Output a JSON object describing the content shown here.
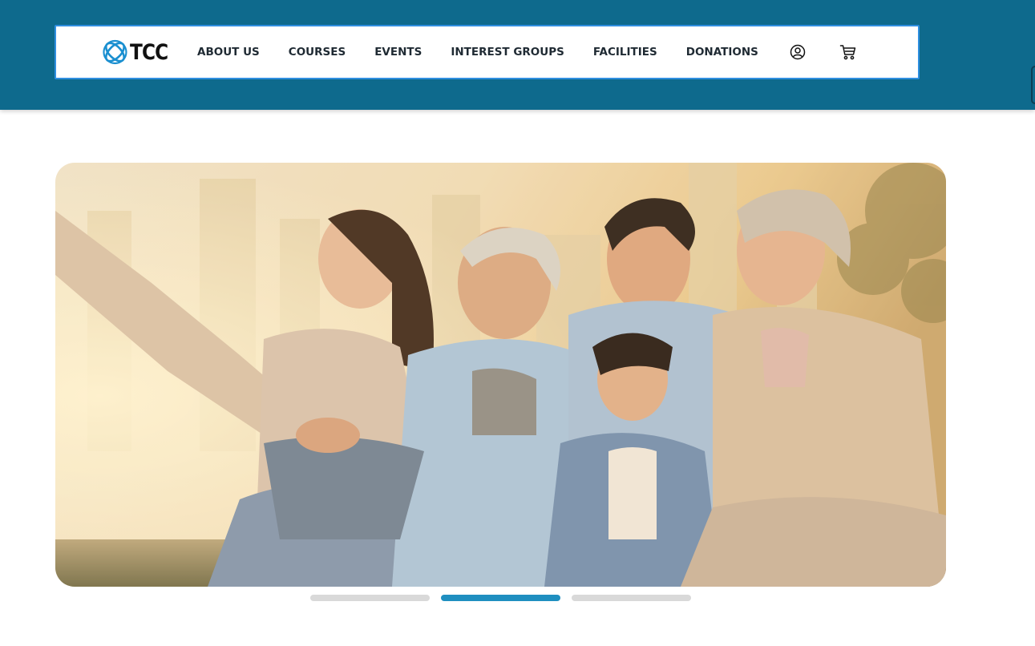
{
  "brand": {
    "logo_text": "TCC",
    "logo_icon": "tcc-orbit-logo-icon"
  },
  "nav": {
    "links": [
      {
        "label": "ABOUT US"
      },
      {
        "label": "COURSES"
      },
      {
        "label": "EVENTS"
      },
      {
        "label": "INTEREST GROUPS"
      },
      {
        "label": "FACILITIES"
      },
      {
        "label": "DONATIONS"
      }
    ],
    "icons": [
      "user-account-icon",
      "shopping-cart-icon"
    ]
  },
  "hero": {
    "image": "family-sunset-photo",
    "description_icon": "photo"
  },
  "carousel": {
    "slides": 3,
    "active_index": 1
  },
  "colors": {
    "header_bg": "#0e6a8d",
    "nav_border": "#2f8fe0",
    "dot_active": "#1f8fc0",
    "dot_inactive": "#d9d9d9"
  }
}
